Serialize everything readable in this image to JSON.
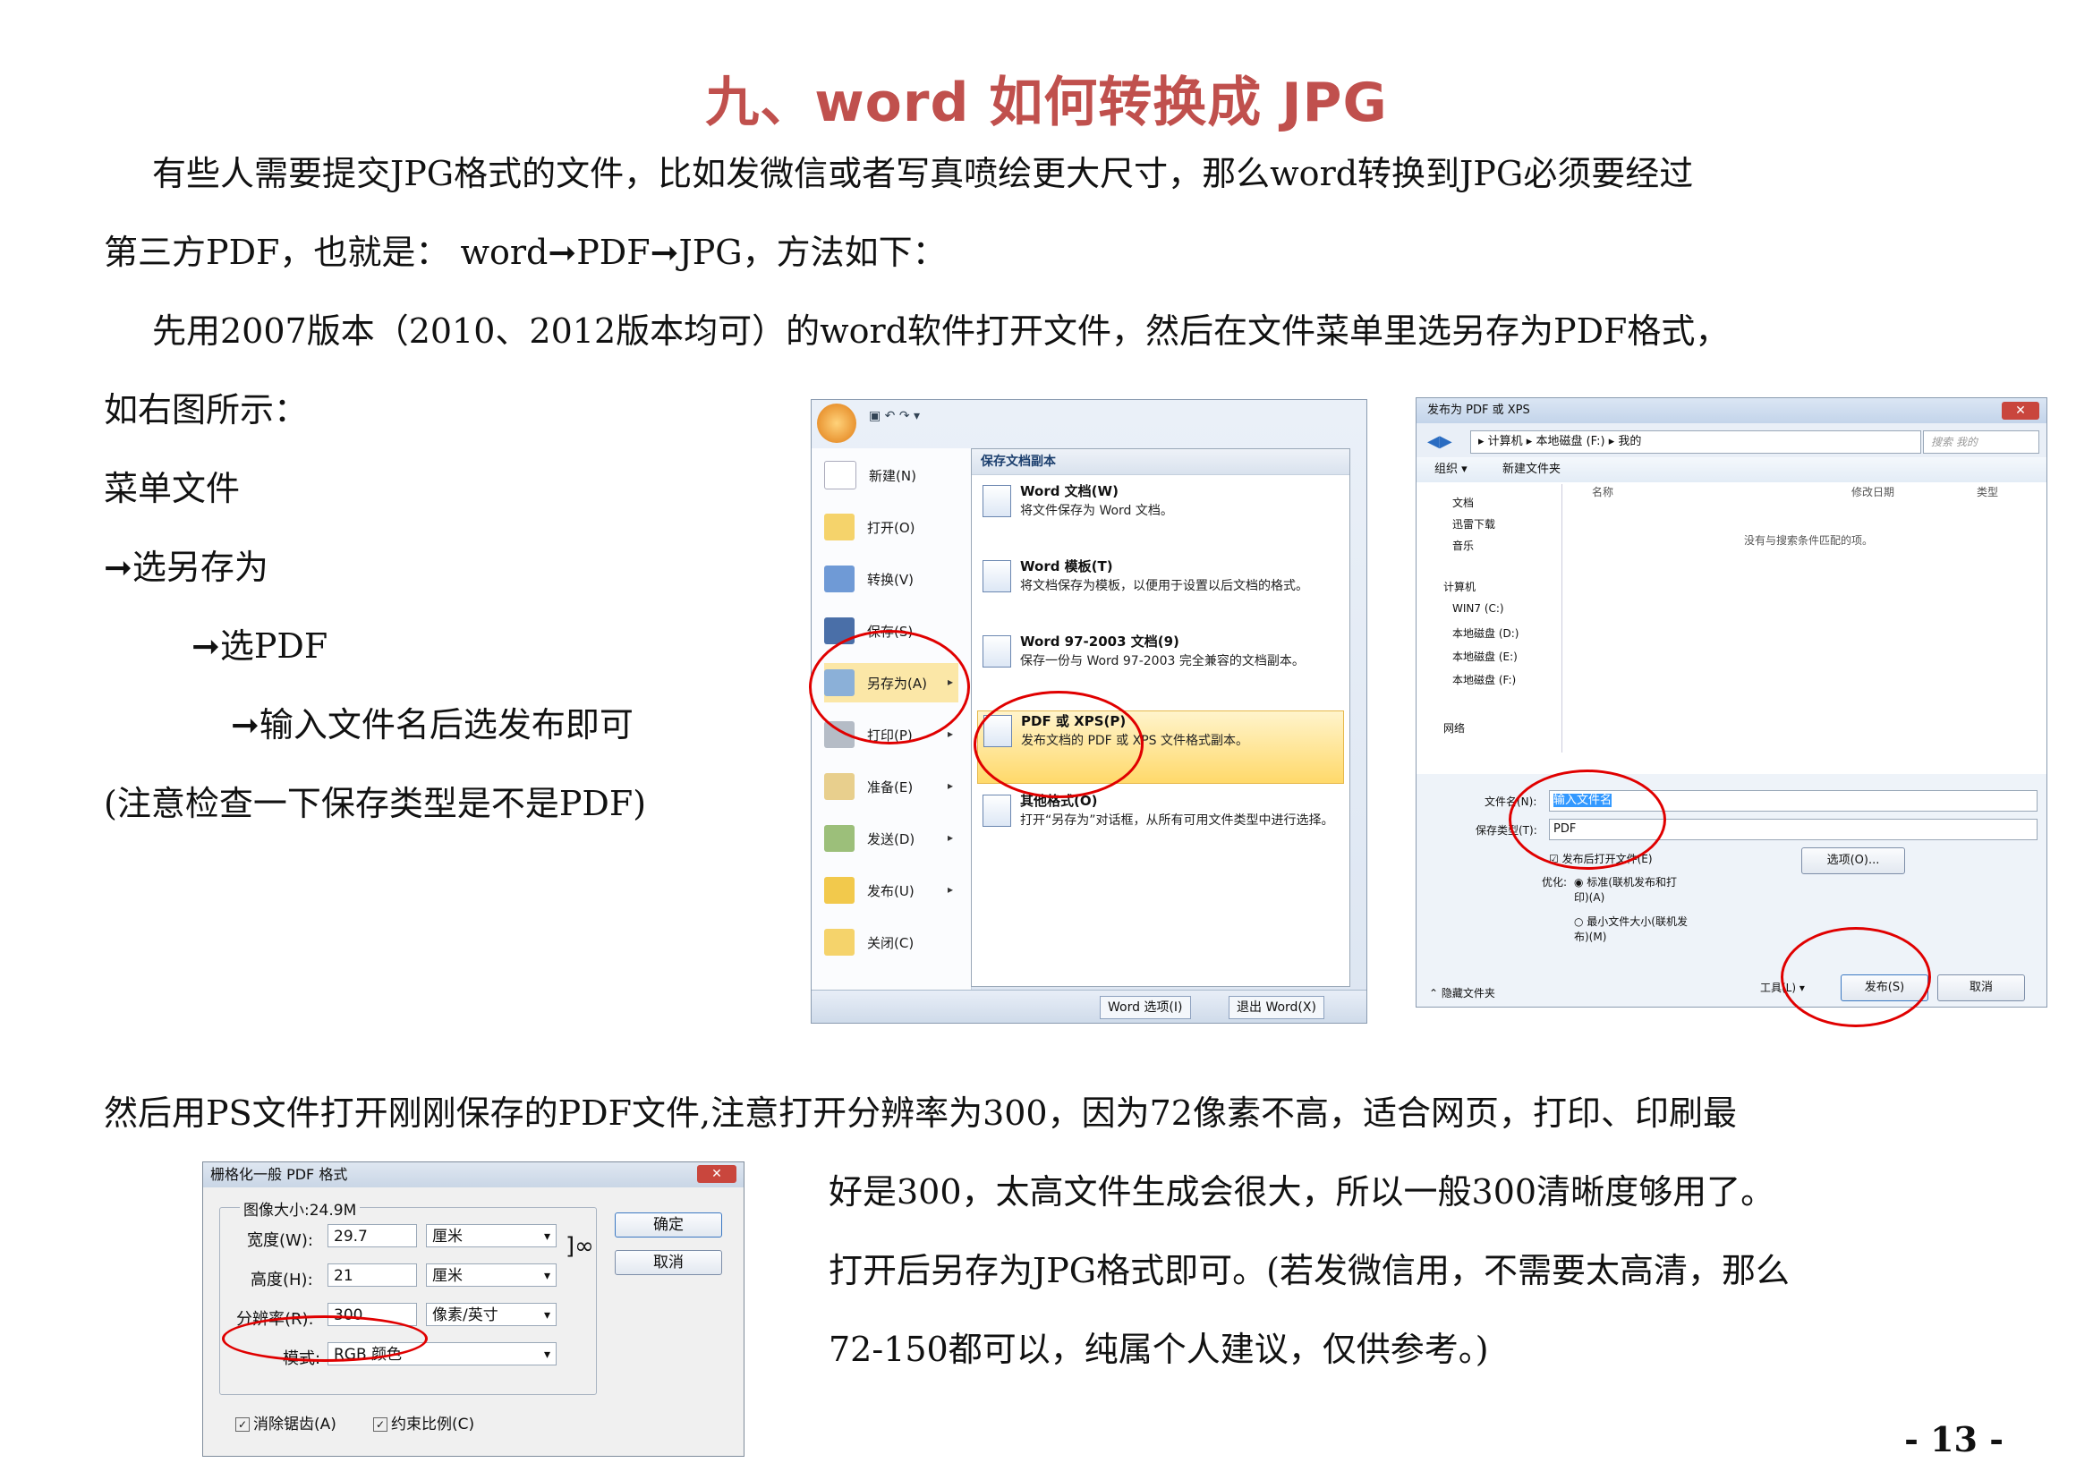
{
  "title": "九、word 如何转换成 JPG",
  "paragraphs": {
    "p1_line1": "有些人需要提交JPG格式的文件，比如发微信或者写真喷绘更大尺寸，那么word转换到JPG必须要经过",
    "p1_line2": "第三方PDF，也就是： word➞PDF➞JPG，方法如下：",
    "p2_line1": "先用2007版本（2010、2012版本均可）的word软件打开文件，然后在文件菜单里选另存为PDF格式，",
    "p2_line2": "如右图所示：",
    "step1": "菜单文件",
    "step2": "➞选另存为",
    "step3": "➞选PDF",
    "step4": "➞输入文件名后选发布即可",
    "note": "(注意检查一下保存类型是不是PDF)",
    "p3_line1": "然后用PS文件打开刚刚保存的PDF文件,注意打开分辨率为300，因为72像素不高，适合网页，打印、印刷最",
    "p3_line2": "好是300，太高文件生成会很大，所以一般300清晰度够用了。",
    "p3_line3": "打开后另存为JPG格式即可。(若发微信用，不需要太高清，那么",
    "p3_line4": "72-150都可以，纯属个人建议，仅供参考。)"
  },
  "word_menu": {
    "left_items": [
      "新建(N)",
      "打开(O)",
      "转换(V)",
      "保存(S)",
      "另存为(A)",
      "打印(P)",
      "准备(E)",
      "发送(D)",
      "发布(U)",
      "关闭(C)"
    ],
    "panel_header": "保存文档副本",
    "options": [
      {
        "title": "Word 文档(W)",
        "desc": "将文件保存为 Word 文档。"
      },
      {
        "title": "Word 模板(T)",
        "desc": "将文档保存为模板，以便用于设置以后文档的格式。"
      },
      {
        "title": "Word 97-2003 文档(9)",
        "desc": "保存一份与 Word 97-2003 完全兼容的文档副本。"
      },
      {
        "title": "PDF 或 XPS(P)",
        "desc": "发布文档的 PDF 或 XPS 文件格式副本。"
      },
      {
        "title": "其他格式(O)",
        "desc": "打开“另存为”对话框，从所有可用文件类型中进行选择。"
      }
    ],
    "btn_options": "Word 选项(I)",
    "btn_exit": "退出 Word(X)"
  },
  "save_dialog": {
    "title": "发布为 PDF 或 XPS",
    "address": "▸ 计算机 ▸ 本地磁盘 (F:) ▸ 我的",
    "search_placeholder": "搜索 我的",
    "toolbar_organize": "组织 ▾",
    "toolbar_newfolder": "新建文件夹",
    "sidebar": [
      "文档",
      "迅雷下载",
      "音乐",
      "计算机",
      "WIN7 (C:)",
      "本地磁盘 (D:)",
      "本地磁盘 (E:)",
      "本地磁盘 (F:)",
      "网络"
    ],
    "col_name": "名称",
    "col_date": "修改日期",
    "col_type": "类型",
    "empty_text": "没有与搜索条件匹配的项。",
    "filename_label": "文件名(N):",
    "filename_value": "输入文件名",
    "filetype_label": "保存类型(T):",
    "filetype_value": "PDF",
    "open_after": "发布后打开文件(E)",
    "optimize_label": "优化:",
    "opt_standard": "标准(联机发布和打印)(A)",
    "opt_min": "最小文件大小(联机发布)(M)",
    "options_btn": "选项(O)...",
    "hide_folders": "隐藏文件夹",
    "tools": "工具(L)",
    "publish": "发布(S)",
    "cancel": "取消"
  },
  "ps_dialog": {
    "title": "栅格化一般 PDF 格式",
    "image_size": "图像大小:24.9M",
    "width_label": "宽度(W):",
    "width_value": "29.7",
    "width_unit": "厘米",
    "height_label": "高度(H):",
    "height_value": "21",
    "height_unit": "厘米",
    "res_label": "分辨率(R):",
    "res_value": "300",
    "res_unit": "像素/英寸",
    "mode_label": "模式:",
    "mode_value": "RGB 颜色",
    "antialias": "消除锯齿(A)",
    "constrain": "约束比例(C)",
    "ok": "确定",
    "cancel": "取消"
  },
  "page_number": "- 13 -"
}
